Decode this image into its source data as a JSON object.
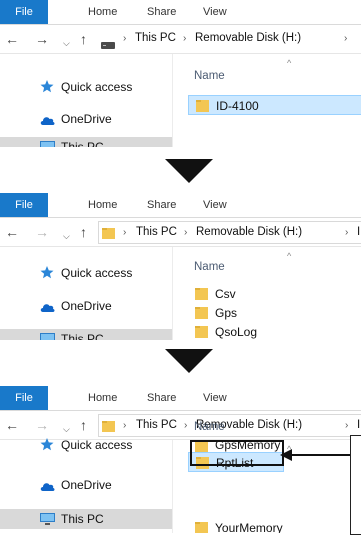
{
  "ribbon": {
    "tabs": [
      "File",
      "Home",
      "Share",
      "View"
    ]
  },
  "sidebar": {
    "items": [
      "Quick access",
      "OneDrive",
      "This PC"
    ]
  },
  "list": {
    "column_name": "Name"
  },
  "panels": [
    {
      "breadcrumb": [
        "This PC",
        "Removable Disk (H:)"
      ],
      "files": [
        "ID-4100"
      ]
    },
    {
      "breadcrumb": [
        "This PC",
        "Removable Disk (H:)",
        "I"
      ],
      "files": [
        "Csv",
        "Gps",
        "QsoLog"
      ]
    },
    {
      "breadcrumb": [
        "This PC",
        "Removable Disk (H:)",
        "I"
      ],
      "files": [
        "GpsMemory",
        "RptList",
        "YourMemory"
      ]
    }
  ],
  "colors": {
    "file_tab": "#1979ca",
    "selection": "#cce8ff",
    "folder": "#f3c652"
  },
  "icons": [
    "back-arrow-icon",
    "forward-arrow-icon",
    "recent-dropdown-icon",
    "up-arrow-icon",
    "drive-icon",
    "folder-icon",
    "quick-access-star-icon",
    "onedrive-cloud-icon",
    "this-pc-monitor-icon",
    "down-arrow-icon"
  ]
}
